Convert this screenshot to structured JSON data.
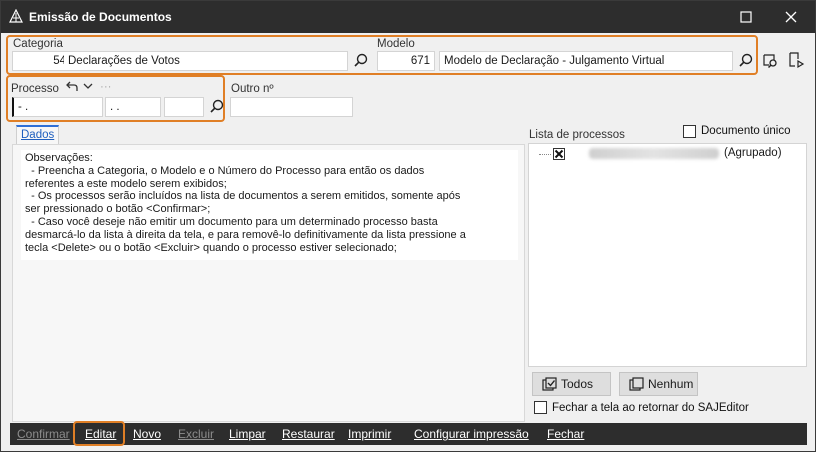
{
  "window": {
    "title": "Emissão de Documentos"
  },
  "categoria": {
    "label": "Categoria",
    "code": "54",
    "name": "Declarações de Votos"
  },
  "modelo": {
    "label": "Modelo",
    "code": "671",
    "name": "Modelo de Declaração - Julgamento Virtual"
  },
  "processo": {
    "label": "Processo",
    "part1": " - .",
    "part2": ". .",
    "part3": "",
    "more": "···"
  },
  "outro": {
    "label": "Outro nº",
    "value": ""
  },
  "tabs": [
    {
      "label": "Dados"
    }
  ],
  "notes": {
    "lines": [
      "Observações:",
      "  - Preencha a Categoria, o Modelo e o Número do Processo para então os dados",
      "referentes a este modelo serem exibidos;",
      "  - Os processos serão incluídos na lista de documentos a serem emitidos, somente após",
      "ser pressionado o botão <Confirmar>;",
      "  - Caso você deseje não emitir um documento para um determinado processo basta",
      "desmarcá-lo da lista à direita da tela, e para removê-lo definitivamente da lista pressione a",
      "tecla <Delete> ou o botão <Excluir> quando o processo estiver selecionado;"
    ]
  },
  "lista": {
    "label": "Lista de processos",
    "documento_unico": "Documento único",
    "item_status": "(Agrupado)"
  },
  "buttons": {
    "todos": "Todos",
    "nenhum": "Nenhum"
  },
  "fechar_opcao": "Fechar a tela ao retornar do SAJEditor",
  "bottom": {
    "confirmar": "Confirmar",
    "editar": "Editar",
    "novo": "Novo",
    "excluir": "Excluir",
    "limpar": "Limpar",
    "restaurar": "Restaurar",
    "imprimir": "Imprimir",
    "configurar": "Configurar impressão",
    "fechar": "Fechar"
  },
  "colors": {
    "highlight": "#e07f26",
    "titlebar": "#2d2d2d",
    "tab_accent": "#2f6fd6"
  }
}
